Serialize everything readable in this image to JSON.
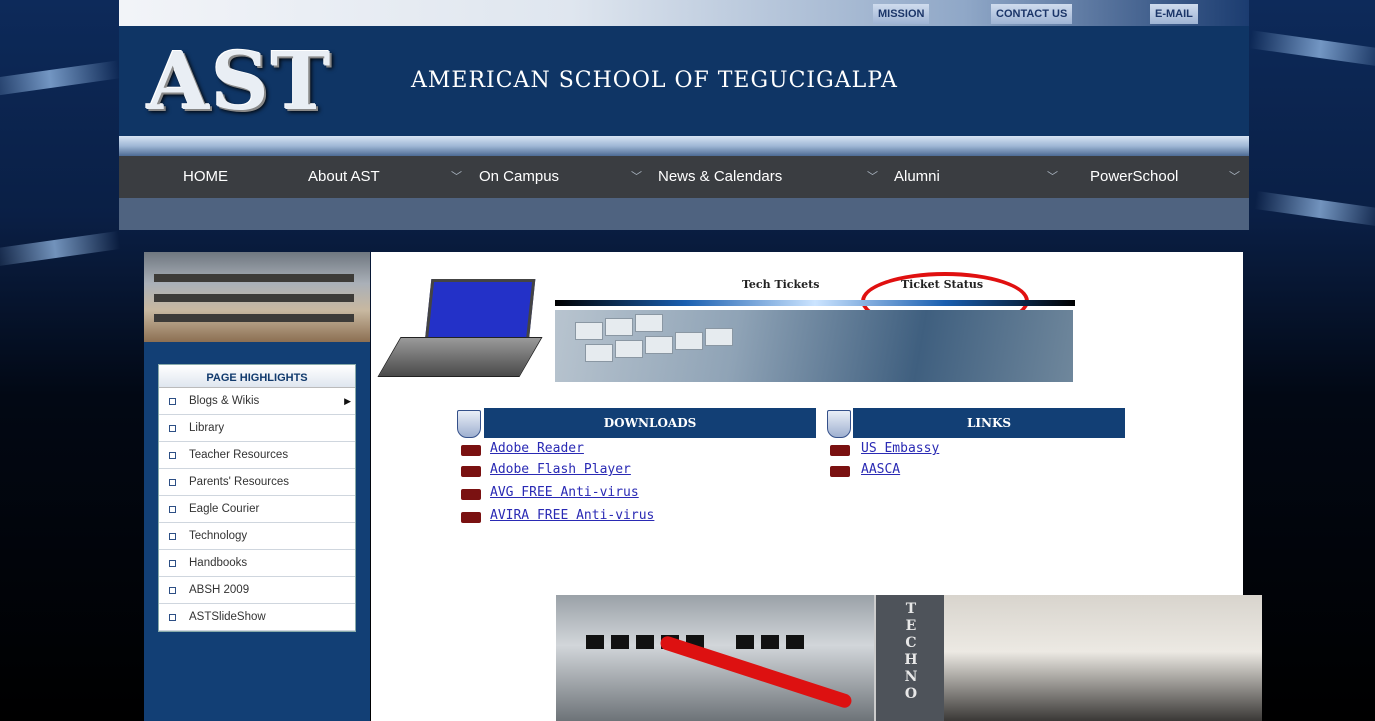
{
  "topbar": {
    "mission": "MISSION",
    "contact": "CONTACT US",
    "email": "E-MAIL"
  },
  "header": {
    "logo": "AST",
    "school_name": "AMERICAN SCHOOL OF TEGUCIGALPA"
  },
  "nav": {
    "items": [
      "HOME",
      "About AST",
      "On Campus",
      "News & Calendars",
      "Alumni",
      "PowerSchool"
    ]
  },
  "sidebar": {
    "title": "PAGE HIGHLIGHTS",
    "items": [
      "Blogs & Wikis",
      "Library",
      "Teacher Resources",
      "Parents' Resources",
      "Eagle Courier",
      "Technology",
      "Handbooks",
      "ABSH 2009",
      "ASTSlideShow"
    ]
  },
  "tabs": {
    "tech_tickets": "Tech Tickets",
    "ticket_status": "Ticket Status"
  },
  "downloads": {
    "title": "DOWNLOADS",
    "items": [
      "Adobe Reader",
      "Adobe Flash Player",
      "AVG FREE Anti-virus",
      "AVIRA FREE Anti-virus"
    ]
  },
  "links": {
    "title": "LINKS",
    "items": [
      "US Embassy",
      "AASCA"
    ]
  },
  "photo_strip": {
    "vertical_text": "TECHNO"
  },
  "colors": {
    "header_blue": "#0f3565",
    "nav_dark": "#3a3d41",
    "link_blue": "#2a2ab4",
    "highlight_red": "#e01010"
  }
}
